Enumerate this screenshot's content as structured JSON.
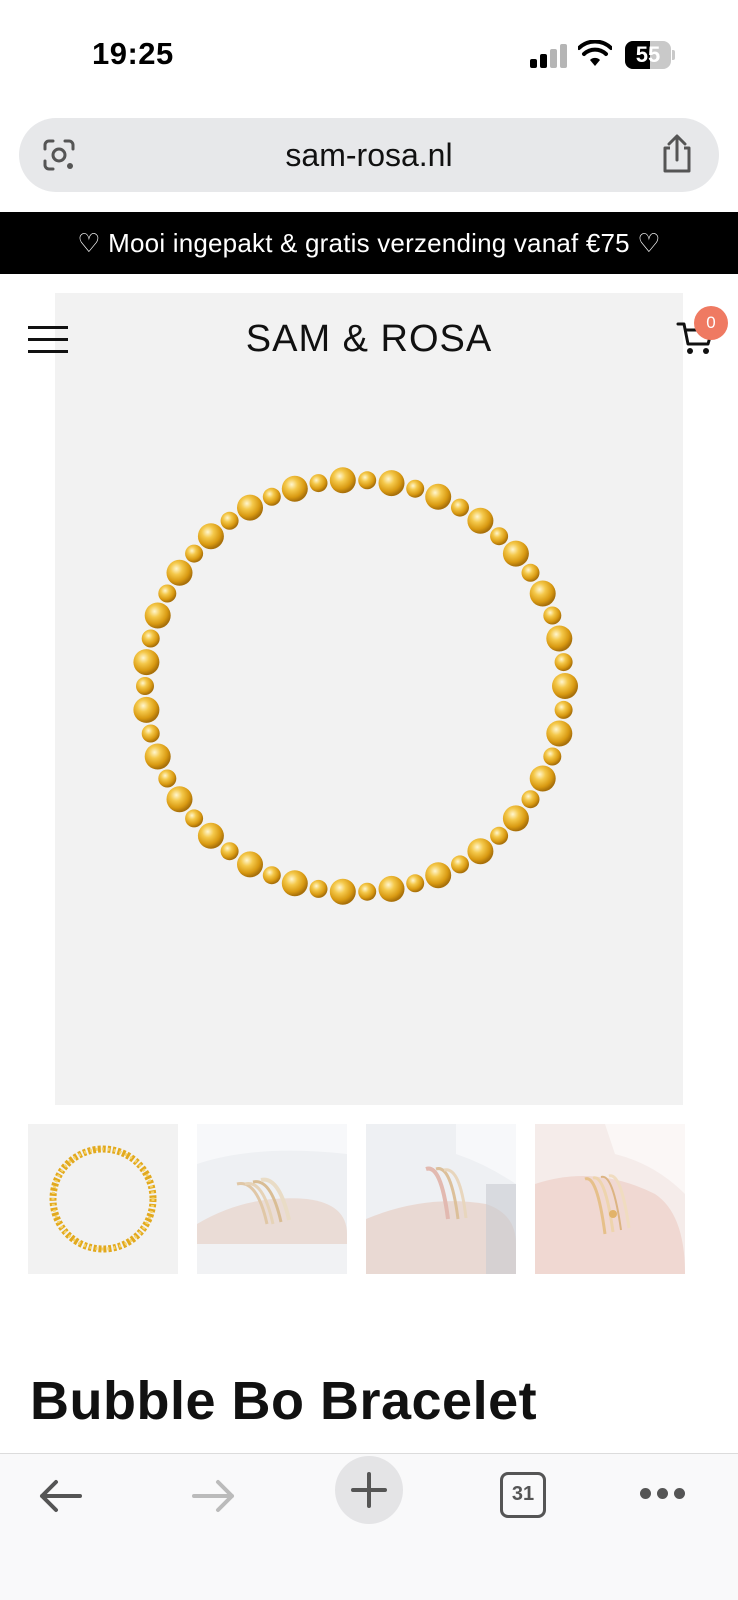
{
  "status_bar": {
    "time": "19:25",
    "battery": "55",
    "battery_level": 0.55,
    "icons": [
      "signal-icon",
      "wifi-icon",
      "battery-icon"
    ]
  },
  "browser": {
    "url": "sam-rosa.nl",
    "icons": [
      "google-lens-icon",
      "share-icon"
    ]
  },
  "promo": {
    "text": "♡ Mooi ingepakt & gratis verzending vanaf €75 ♡"
  },
  "header": {
    "logo": "SAM & ROSA",
    "cart_count": "0",
    "icons": [
      "menu-icon",
      "cart-icon"
    ]
  },
  "product": {
    "title": "Bubble Bo Bracelet",
    "thumbnails": [
      "bracelet-thumbnail",
      "wrist-stack-thumbnail",
      "wrist-stack-thumbnail",
      "wrist-stack-thumbnail"
    ]
  },
  "bottom_nav": {
    "tab_count": "31",
    "icons": [
      "back-arrow-icon",
      "forward-arrow-icon",
      "plus-icon",
      "tabs-icon",
      "more-icon"
    ]
  },
  "colors": {
    "promo_bg": "#000000",
    "cart_badge": "#ef7a62",
    "gold": "#e9b42a",
    "image_bg": "#f2f2f2"
  }
}
